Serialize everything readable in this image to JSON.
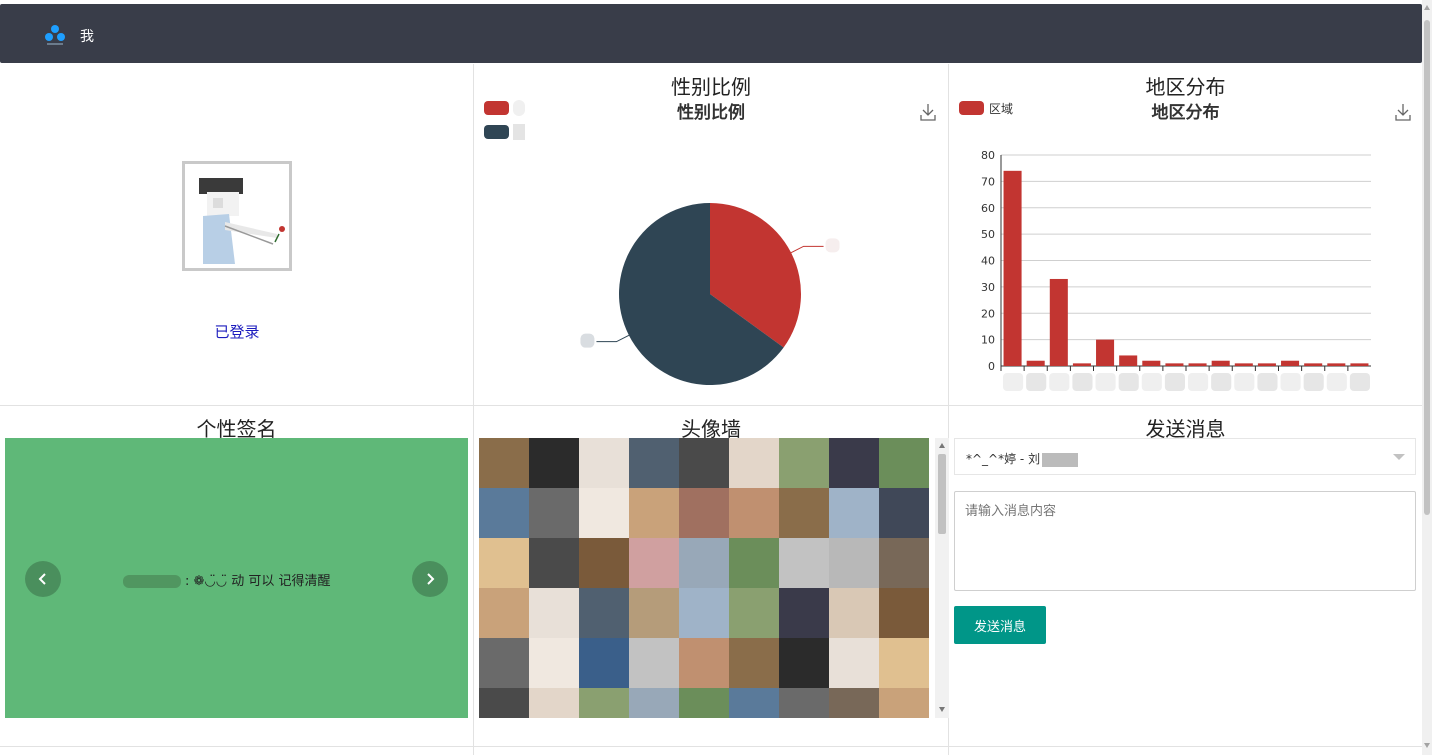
{
  "nav": {
    "me_label": "我"
  },
  "profile": {
    "login_status": "已登录"
  },
  "gender_panel": {
    "title": "性别比例",
    "chart_title": "性别比例"
  },
  "region_panel": {
    "title": "地区分布",
    "chart_title": "地区分布",
    "legend_label": "区域"
  },
  "signature_panel": {
    "title": "个性签名",
    "text": ": ❁◡̈◡̈ 动 可以 记得清醒"
  },
  "avatar_wall": {
    "title": "头像墙"
  },
  "message_panel": {
    "title": "发送消息",
    "recipient": "*^_^*婷 - 刘",
    "placeholder": "请输入消息内容",
    "send_label": "发送消息"
  },
  "colors": {
    "red": "#c23531",
    "navy": "#2f4554",
    "green": "#5fb878",
    "teal": "#009688",
    "nav_bg": "#393d49"
  },
  "icons": [
    "logo-icon",
    "download-icon",
    "chevron-left-icon",
    "chevron-right-icon",
    "dropdown-arrow-icon"
  ],
  "chart_data": [
    {
      "type": "pie",
      "title": "性别比例",
      "series": [
        {
          "values": [
            35,
            65
          ],
          "colors": [
            "#c23531",
            "#2f4554"
          ]
        }
      ]
    },
    {
      "type": "bar",
      "title": "地区分布",
      "legend": [
        "区域"
      ],
      "categories": [
        "",
        "",
        "",
        "",
        "",
        "",
        "",
        "",
        "",
        "",
        "",
        "",
        "",
        "",
        "",
        ""
      ],
      "series": [
        {
          "name": "区域",
          "values": [
            74,
            2,
            33,
            1,
            10,
            4,
            2,
            1,
            1,
            2,
            1,
            1,
            2,
            1,
            1,
            1
          ]
        }
      ],
      "ylim": [
        0,
        80
      ],
      "yticks": [
        0,
        10,
        20,
        30,
        40,
        50,
        60,
        70,
        80
      ],
      "grid": true
    }
  ]
}
